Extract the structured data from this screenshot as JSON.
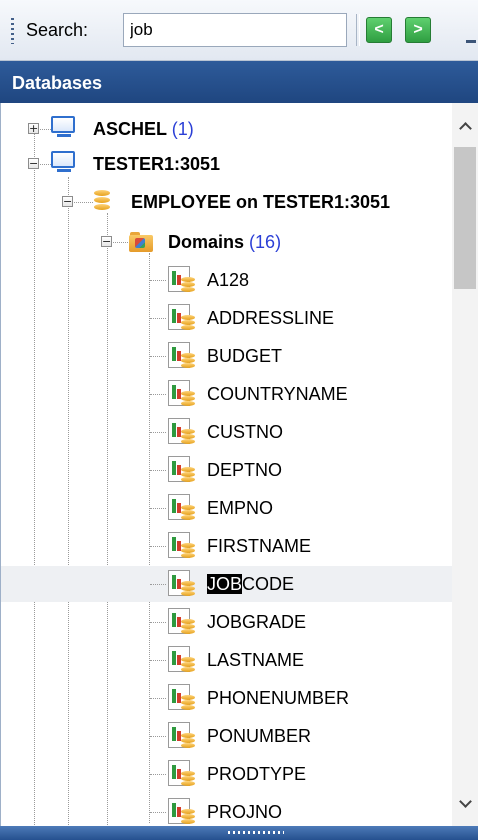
{
  "toolbar": {
    "search_label": "Search:",
    "search_value": "job",
    "prev_icon": "chevron-left-icon",
    "next_icon": "chevron-right-icon",
    "prev_glyph": "<",
    "next_glyph": ">"
  },
  "panel": {
    "title": "Databases"
  },
  "tree": {
    "servers": [
      {
        "name": "ASCHEL",
        "count": "(1)",
        "expanded": false
      },
      {
        "name": "TESTER1:3051",
        "expanded": true
      }
    ],
    "database": {
      "name": "EMPLOYEE on TESTER1:3051",
      "expanded": true
    },
    "domains": {
      "label": "Domains",
      "count": "(16)",
      "expanded": true,
      "items": [
        "A128",
        "ADDRESSLINE",
        "BUDGET",
        "COUNTRYNAME",
        "CUSTNO",
        "DEPTNO",
        "EMPNO",
        "FIRSTNAME",
        "JOBCODE",
        "JOBGRADE",
        "LASTNAME",
        "PHONENUMBER",
        "PONUMBER",
        "PRODTYPE",
        "PROJNO"
      ],
      "selected_item": "JOBCODE",
      "match_prefix": "JOB",
      "match_suffix": "CODE"
    }
  },
  "colors": {
    "header_bg": "#2e5b9a",
    "count_text": "#2b3fd6",
    "nav_button": "#3aa84b",
    "highlight_bg": "#000000"
  }
}
